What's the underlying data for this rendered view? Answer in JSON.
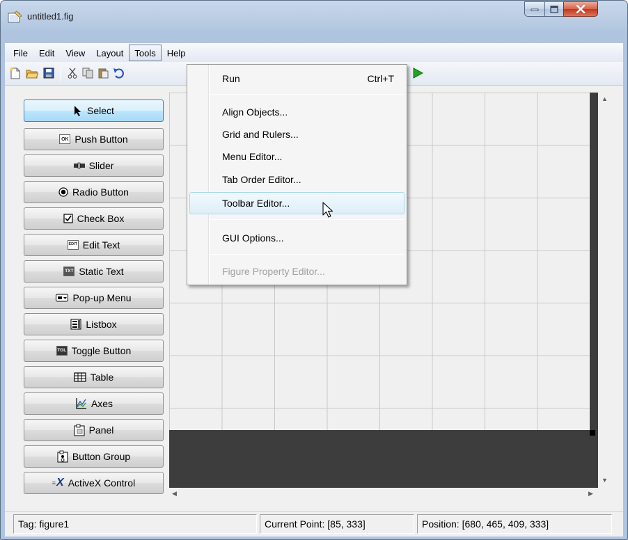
{
  "window": {
    "title": "untitled1.fig",
    "title_icon": "figure-file-icon"
  },
  "menubar": {
    "items": [
      "File",
      "Edit",
      "View",
      "Layout",
      "Tools",
      "Help"
    ],
    "open": "Tools"
  },
  "toolbar": {
    "icons": [
      "new-file-icon",
      "open-folder-icon",
      "save-icon",
      "cut-icon",
      "copy-icon",
      "paste-icon",
      "undo-icon",
      "run-icon"
    ]
  },
  "palette": {
    "items": [
      {
        "label": "Select",
        "icon": "arrow-pointer-icon"
      },
      {
        "label": "Push Button",
        "icon": "push-button-icon",
        "glyph": "OK"
      },
      {
        "label": "Slider",
        "icon": "slider-icon"
      },
      {
        "label": "Radio Button",
        "icon": "radio-button-icon"
      },
      {
        "label": "Check Box",
        "icon": "checkbox-icon"
      },
      {
        "label": "Edit Text",
        "icon": "edit-text-icon",
        "glyph": "EDIT"
      },
      {
        "label": "Static Text",
        "icon": "static-text-icon",
        "glyph": "TXT"
      },
      {
        "label": "Pop-up Menu",
        "icon": "popup-menu-icon"
      },
      {
        "label": "Listbox",
        "icon": "listbox-icon"
      },
      {
        "label": "Toggle Button",
        "icon": "toggle-button-icon",
        "glyph": "TGL"
      },
      {
        "label": "Table",
        "icon": "table-icon"
      },
      {
        "label": "Axes",
        "icon": "axes-icon"
      },
      {
        "label": "Panel",
        "icon": "panel-icon"
      },
      {
        "label": "Button Group",
        "icon": "button-group-icon"
      },
      {
        "label": "ActiveX Control",
        "icon": "activex-icon",
        "glyph": "X"
      }
    ],
    "selected": "Select"
  },
  "tools_menu": {
    "items": [
      {
        "label": "Run",
        "shortcut": "Ctrl+T",
        "state": "normal"
      },
      {
        "label": "Align Objects...",
        "shortcut": "",
        "state": "normal"
      },
      {
        "label": "Grid and Rulers...",
        "shortcut": "",
        "state": "normal"
      },
      {
        "label": "Menu Editor...",
        "shortcut": "",
        "state": "normal"
      },
      {
        "label": "Tab Order Editor...",
        "shortcut": "",
        "state": "normal"
      },
      {
        "label": "Toolbar Editor...",
        "shortcut": "",
        "state": "hover"
      },
      {
        "label": "GUI Options...",
        "shortcut": "",
        "state": "normal"
      },
      {
        "label": "Figure Property Editor...",
        "shortcut": "",
        "state": "disabled"
      }
    ]
  },
  "status": {
    "tag": "Tag: figure1",
    "current_point": "Current Point:  [85, 333]",
    "position": "Position: [680, 465, 409, 333]"
  },
  "colors": {
    "run_green": "#1fa51f",
    "canvas_dark": "#3d3d3d",
    "close_red": "#c4371c"
  }
}
